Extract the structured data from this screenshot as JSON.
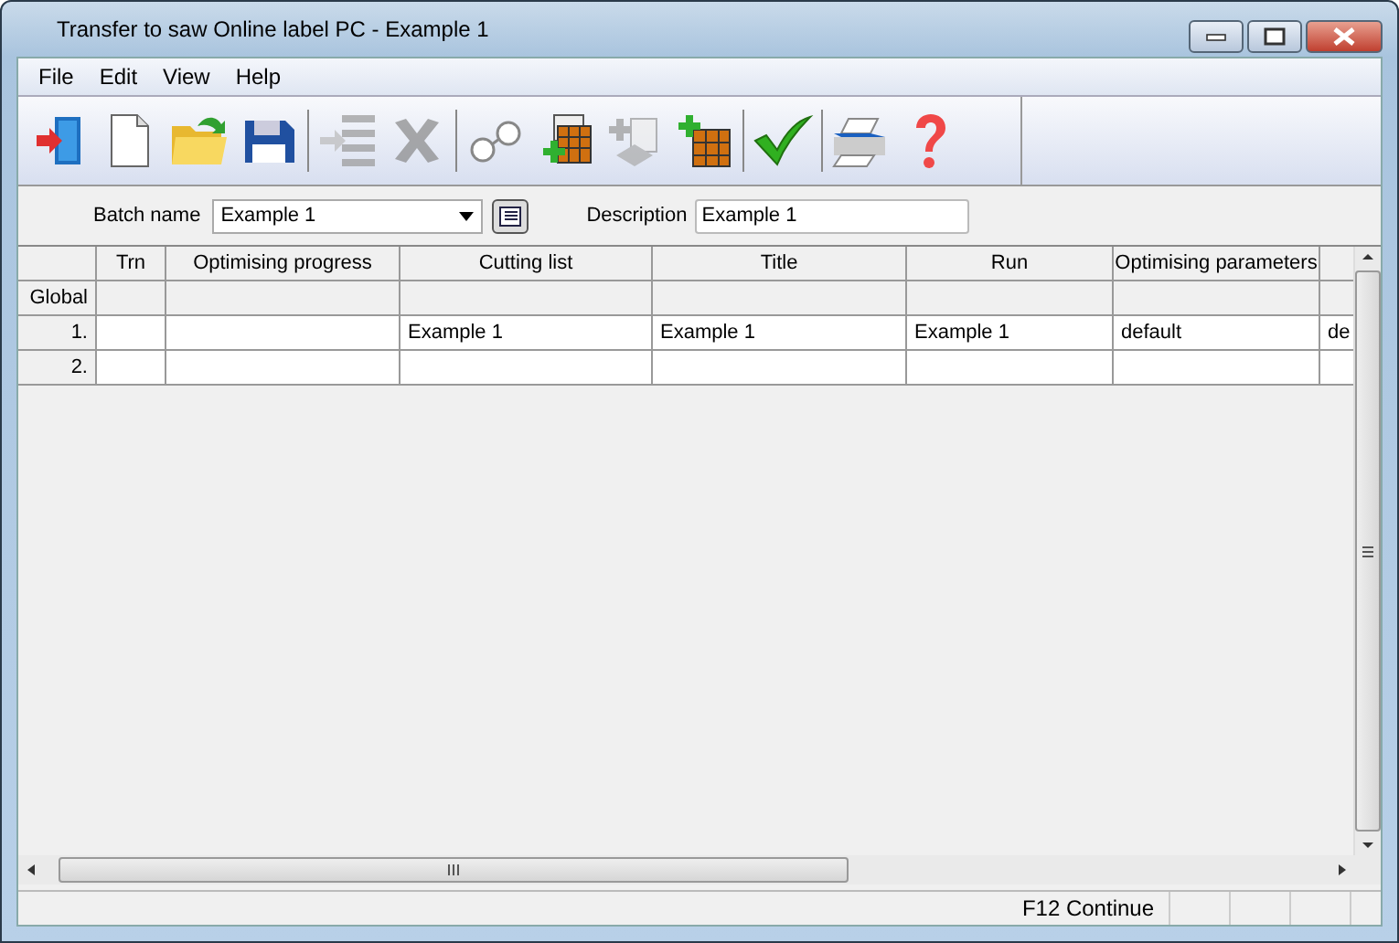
{
  "window": {
    "title": "Transfer to saw Online label PC - Example 1"
  },
  "menu": [
    "File",
    "Edit",
    "View",
    "Help"
  ],
  "toolbar_groups": [
    {
      "tools": [
        {
          "kind": "exit",
          "disabled": false
        },
        {
          "kind": "new",
          "disabled": false
        },
        {
          "kind": "open",
          "disabled": false
        },
        {
          "kind": "save",
          "disabled": false
        }
      ]
    },
    {
      "tools": [
        {
          "kind": "insert",
          "disabled": true
        },
        {
          "kind": "delete",
          "disabled": true
        }
      ]
    },
    {
      "tools": [
        {
          "kind": "glasses",
          "disabled": false
        },
        {
          "kind": "add-batch",
          "disabled": false
        },
        {
          "kind": "add-list",
          "disabled": true
        },
        {
          "kind": "add-grid",
          "disabled": false
        }
      ]
    },
    {
      "tools": [
        {
          "kind": "check",
          "disabled": false
        }
      ]
    },
    {
      "tools": [
        {
          "kind": "print",
          "disabled": false
        },
        {
          "kind": "help",
          "disabled": false
        }
      ]
    }
  ],
  "batch_name": {
    "label": "Batch name",
    "value": "Example 1"
  },
  "description": {
    "label": "Description",
    "value": "Example 1"
  },
  "table": {
    "columns": [
      "Trn",
      "Optimising progress",
      "Cutting list",
      "Title",
      "Run",
      "Optimising parameters"
    ],
    "rows": [
      {
        "kind": "global",
        "header": "Global",
        "cells": [
          "",
          "",
          "",
          "",
          "",
          "",
          ""
        ]
      },
      {
        "kind": "data",
        "header": "1.",
        "cells": [
          "",
          "",
          "Example 1",
          "Example 1",
          "Example 1",
          "default",
          "de"
        ]
      },
      {
        "kind": "data",
        "header": "2.",
        "cells": [
          "",
          "",
          "",
          "",
          "",
          "",
          ""
        ]
      }
    ]
  },
  "status_bar": [
    "F12 Continue"
  ]
}
